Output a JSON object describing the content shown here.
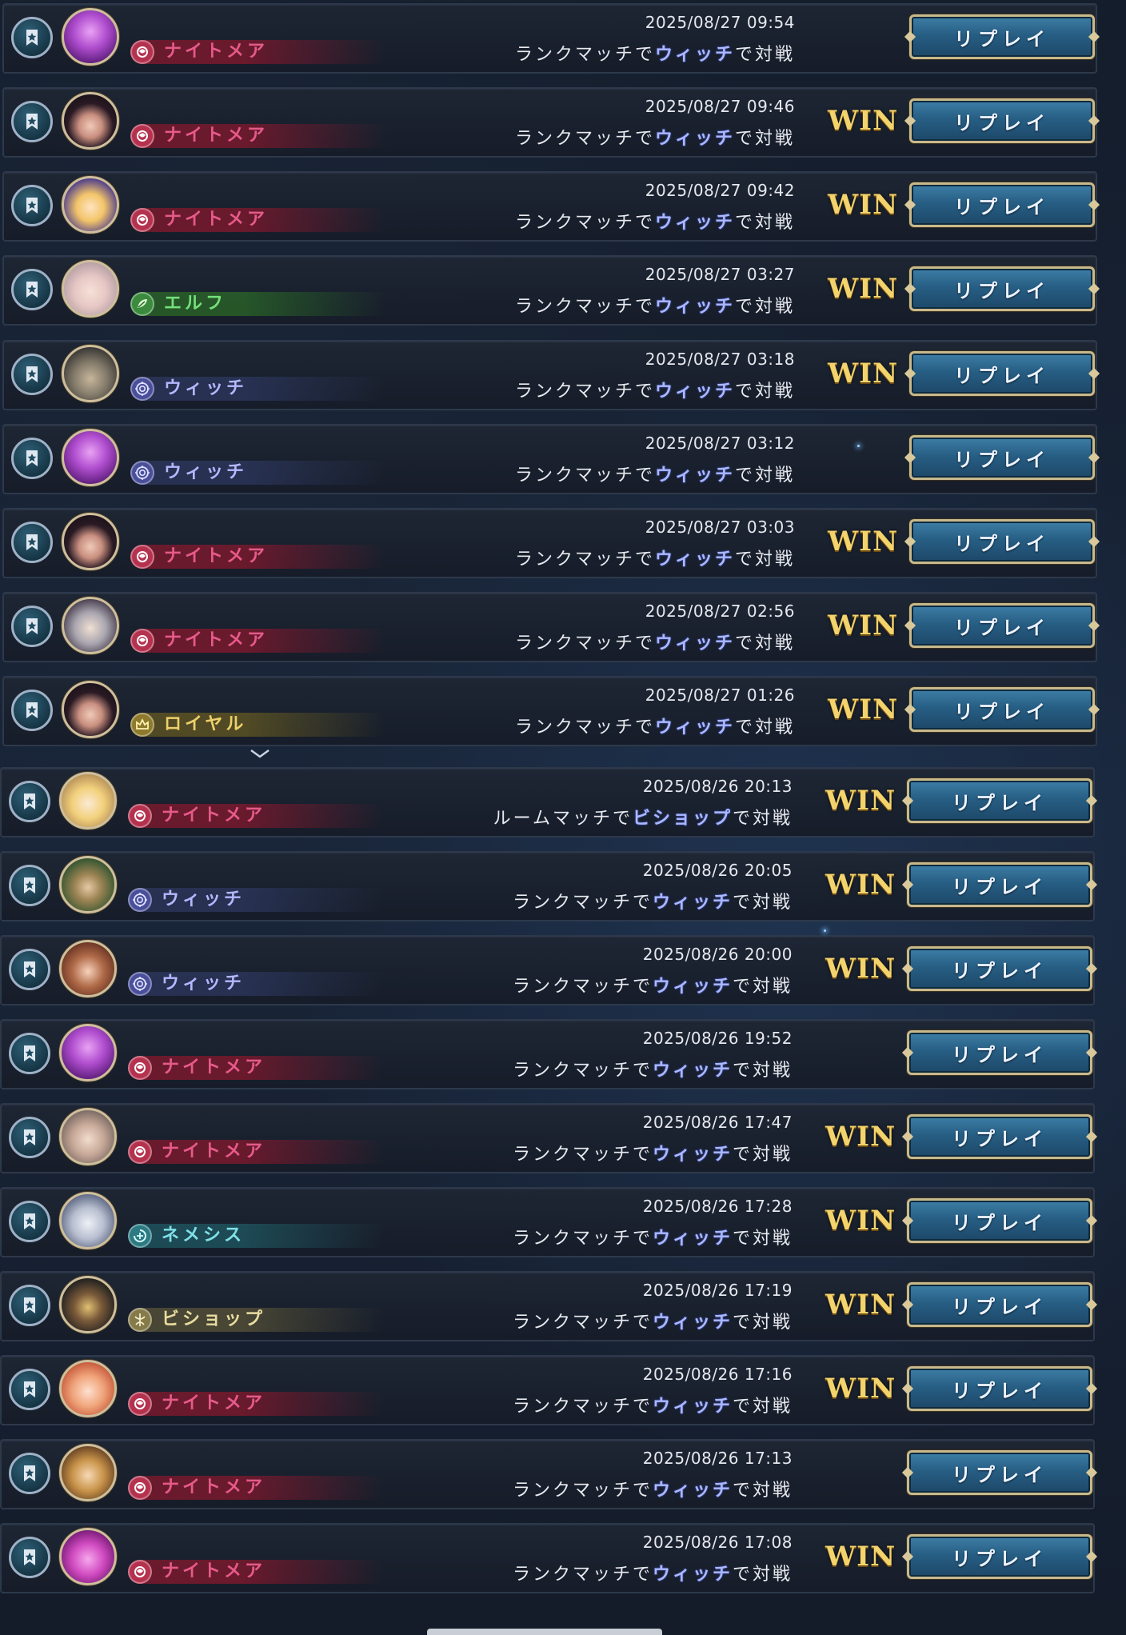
{
  "replay_label": "リプレイ",
  "win_label": "WIN",
  "colors": {
    "nightmare": "#e65a8a",
    "elf": "#74e07a",
    "witch": "#b4b8ff",
    "royal": "#ecd06a",
    "nemesis": "#7fe0e8",
    "bishop": "#e8dca0",
    "win_gold": "#f3d36c",
    "replay_blue": "#275e84"
  },
  "battles": [
    {
      "datetime": "2025/08/27 09:54",
      "cls": "ナイトメア",
      "cls_key": "nightmare",
      "desc_pre": "ランクマッチで",
      "opponent": "ウィッチ",
      "desc_post": "で対戦",
      "win": false,
      "avatar": "purple-witch"
    },
    {
      "datetime": "2025/08/27 09:46",
      "cls": "ナイトメア",
      "cls_key": "nightmare",
      "desc_pre": "ランクマッチで",
      "opponent": "ウィッチ",
      "desc_post": "で対戦",
      "win": true,
      "avatar": "dark-girl"
    },
    {
      "datetime": "2025/08/27 09:42",
      "cls": "ナイトメア",
      "cls_key": "nightmare",
      "desc_pre": "ランクマッチで",
      "opponent": "ウィッチ",
      "desc_post": "で対戦",
      "win": true,
      "avatar": "blonde-witch"
    },
    {
      "datetime": "2025/08/27 03:27",
      "cls": "エルフ",
      "cls_key": "elf",
      "desc_pre": "ランクマッチで",
      "opponent": "ウィッチ",
      "desc_post": "で対戦",
      "win": true,
      "avatar": "white-hair"
    },
    {
      "datetime": "2025/08/27 03:18",
      "cls": "ウィッチ",
      "cls_key": "witch",
      "desc_pre": "ランクマッチで",
      "opponent": "ウィッチ",
      "desc_post": "で対戦",
      "win": true,
      "avatar": "old-wizard"
    },
    {
      "datetime": "2025/08/27 03:12",
      "cls": "ウィッチ",
      "cls_key": "witch",
      "desc_pre": "ランクマッチで",
      "opponent": "ウィッチ",
      "desc_post": "で対戦",
      "win": false,
      "avatar": "purple-witch"
    },
    {
      "datetime": "2025/08/27 03:03",
      "cls": "ナイトメア",
      "cls_key": "nightmare",
      "desc_pre": "ランクマッチで",
      "opponent": "ウィッチ",
      "desc_post": "で対戦",
      "win": true,
      "avatar": "dark-girl"
    },
    {
      "datetime": "2025/08/27 02:56",
      "cls": "ナイトメア",
      "cls_key": "nightmare",
      "desc_pre": "ランクマッチで",
      "opponent": "ウィッチ",
      "desc_post": "で対戦",
      "win": true,
      "avatar": "silver-girl"
    },
    {
      "datetime": "2025/08/27 01:26",
      "cls": "ロイヤル",
      "cls_key": "royal",
      "desc_pre": "ランクマッチで",
      "opponent": "ウィッチ",
      "desc_post": "で対戦",
      "win": true,
      "avatar": "dark-girl"
    },
    {
      "datetime": "2025/08/26 20:13",
      "cls": "ナイトメア",
      "cls_key": "nightmare",
      "desc_pre": "ルームマッチで",
      "opponent": "ビショップ",
      "desc_post": "で対戦",
      "win": true,
      "avatar": "blonde-girl"
    },
    {
      "datetime": "2025/08/26 20:05",
      "cls": "ウィッチ",
      "cls_key": "witch",
      "desc_pre": "ランクマッチで",
      "opponent": "ウィッチ",
      "desc_post": "で対戦",
      "win": true,
      "avatar": "green-man"
    },
    {
      "datetime": "2025/08/26 20:00",
      "cls": "ウィッチ",
      "cls_key": "witch",
      "desc_pre": "ランクマッチで",
      "opponent": "ウィッチ",
      "desc_post": "で対戦",
      "win": true,
      "avatar": "brown-girl"
    },
    {
      "datetime": "2025/08/26 19:52",
      "cls": "ナイトメア",
      "cls_key": "nightmare",
      "desc_pre": "ランクマッチで",
      "opponent": "ウィッチ",
      "desc_post": "で対戦",
      "win": false,
      "avatar": "purple-witch"
    },
    {
      "datetime": "2025/08/26 17:47",
      "cls": "ナイトメア",
      "cls_key": "nightmare",
      "desc_pre": "ランクマッチで",
      "opponent": "ウィッチ",
      "desc_post": "で対戦",
      "win": true,
      "avatar": "pale-man"
    },
    {
      "datetime": "2025/08/26 17:28",
      "cls": "ネメシス",
      "cls_key": "nemesis",
      "desc_pre": "ランクマッチで",
      "opponent": "ウィッチ",
      "desc_post": "で対戦",
      "win": true,
      "avatar": "silver-robot"
    },
    {
      "datetime": "2025/08/26 17:19",
      "cls": "ビショップ",
      "cls_key": "bishop",
      "desc_pre": "ランクマッチで",
      "opponent": "ウィッチ",
      "desc_post": "で対戦",
      "win": true,
      "avatar": "dark-priest"
    },
    {
      "datetime": "2025/08/26 17:16",
      "cls": "ナイトメア",
      "cls_key": "nightmare",
      "desc_pre": "ランクマッチで",
      "opponent": "ウィッチ",
      "desc_post": "で対戦",
      "win": true,
      "avatar": "orange-girl"
    },
    {
      "datetime": "2025/08/26 17:13",
      "cls": "ナイトメア",
      "cls_key": "nightmare",
      "desc_pre": "ランクマッチで",
      "opponent": "ウィッチ",
      "desc_post": "で対戦",
      "win": false,
      "avatar": "gold-girl"
    },
    {
      "datetime": "2025/08/26 17:08",
      "cls": "ナイトメア",
      "cls_key": "nightmare",
      "desc_pre": "ランクマッチで",
      "opponent": "ウィッチ",
      "desc_post": "で対戦",
      "win": true,
      "avatar": "magenta-demon"
    }
  ]
}
